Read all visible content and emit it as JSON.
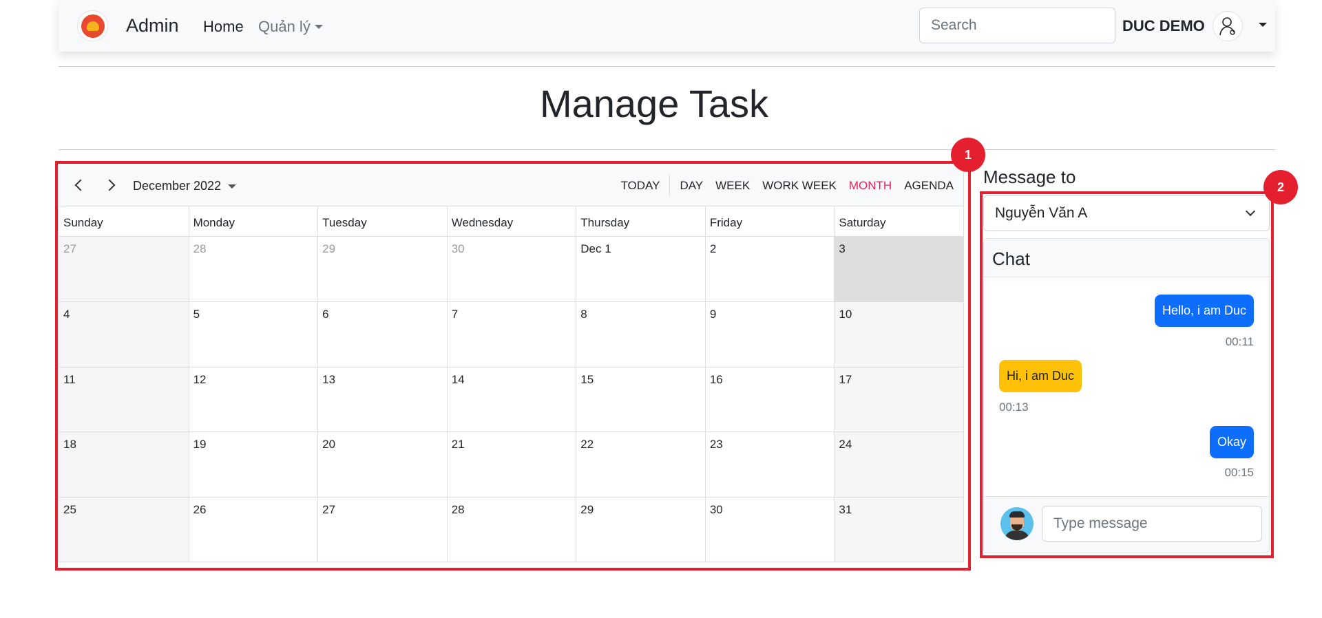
{
  "navbar": {
    "brand": "Admin",
    "home": "Home",
    "manage": "Quản lý",
    "search_placeholder": "Search",
    "user_name": "DUC DEMO"
  },
  "page": {
    "title": "Manage Task"
  },
  "calendar": {
    "month_label": "December 2022",
    "views": {
      "today": "TODAY",
      "day": "DAY",
      "week": "WEEK",
      "work_week": "WORK WEEK",
      "month": "MONTH",
      "agenda": "AGENDA"
    },
    "active_view_color": "#e0245e",
    "weekdays": [
      "Sunday",
      "Monday",
      "Tuesday",
      "Wednesday",
      "Thursday",
      "Friday",
      "Saturday"
    ],
    "weeks": [
      [
        "27",
        "28",
        "29",
        "30",
        "Dec 1",
        "2",
        "3"
      ],
      [
        "4",
        "5",
        "6",
        "7",
        "8",
        "9",
        "10"
      ],
      [
        "11",
        "12",
        "13",
        "14",
        "15",
        "16",
        "17"
      ],
      [
        "18",
        "19",
        "20",
        "21",
        "22",
        "23",
        "24"
      ],
      [
        "25",
        "26",
        "27",
        "28",
        "29",
        "30",
        "31"
      ]
    ]
  },
  "chat": {
    "message_to_label": "Message to",
    "recipient": "Nguyễn Văn A",
    "header": "Chat",
    "messages": [
      {
        "text": "Hello, i am Duc",
        "time": "00:11",
        "from": "me"
      },
      {
        "text": "Hi, i am Duc",
        "time": "00:13",
        "from": "them"
      },
      {
        "text": "Okay",
        "time": "00:15",
        "from": "me"
      }
    ],
    "input_placeholder": "Type message",
    "colors": {
      "me": "#0d6efd",
      "them": "#ffc107"
    }
  },
  "annotations": {
    "badge_1": "1",
    "badge_2": "2",
    "color": "#e5202e"
  }
}
